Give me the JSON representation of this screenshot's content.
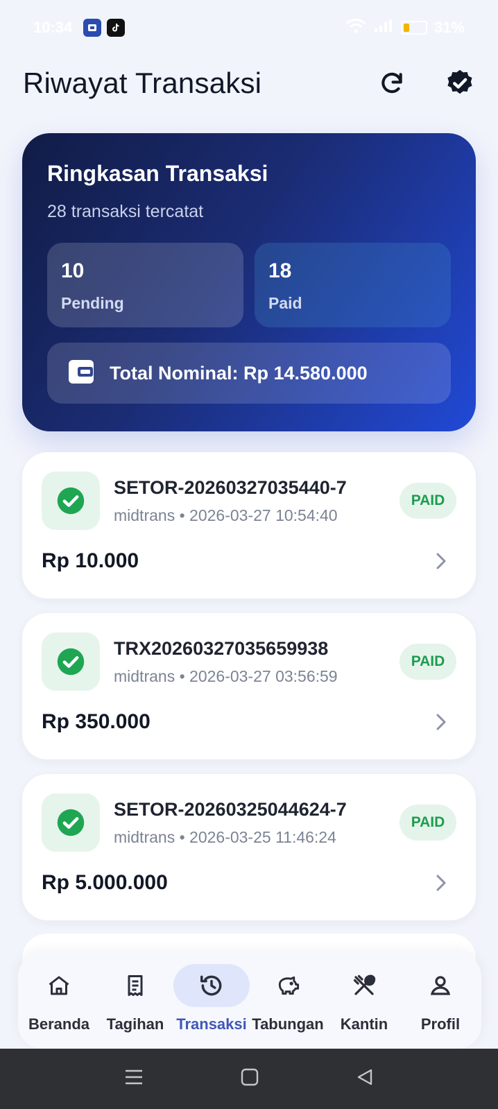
{
  "status_bar": {
    "time": "10:34",
    "battery_percent": "31%",
    "colors": {
      "battery_level": "#f4b400"
    }
  },
  "header": {
    "title": "Riwayat Transaksi",
    "icons": [
      "refresh-icon",
      "verified-badge-icon"
    ]
  },
  "summary": {
    "title": "Ringkasan Transaksi",
    "subtitle": "28 transaksi tercatat",
    "pending": {
      "count": "10",
      "label": "Pending"
    },
    "paid": {
      "count": "18",
      "label": "Paid"
    },
    "total_label": "Total Nominal: Rp 14.580.000",
    "colors": {
      "gradient_start": "#111c46",
      "gradient_end": "#2149d6"
    }
  },
  "transactions": [
    {
      "id": "SETOR-20260327035440-7",
      "meta": "midtrans • 2026-03-27 10:54:40",
      "status": "PAID",
      "amount": "Rp 10.000"
    },
    {
      "id": "TRX20260327035659938",
      "meta": "midtrans • 2026-03-27 03:56:59",
      "status": "PAID",
      "amount": "Rp 350.000"
    },
    {
      "id": "SETOR-20260325044624-7",
      "meta": "midtrans • 2026-03-25 11:46:24",
      "status": "PAID",
      "amount": "Rp 5.000.000"
    }
  ],
  "status_colors": {
    "paid_bg": "#e5f4ea",
    "paid_text": "#1e9c4f"
  },
  "bottom_nav": {
    "items": [
      {
        "label": "Beranda",
        "icon": "home-icon"
      },
      {
        "label": "Tagihan",
        "icon": "receipt-icon"
      },
      {
        "label": "Transaksi",
        "icon": "history-icon",
        "active": true
      },
      {
        "label": "Tabungan",
        "icon": "piggy-bank-icon"
      },
      {
        "label": "Kantin",
        "icon": "utensils-icon"
      },
      {
        "label": "Profil",
        "icon": "user-icon"
      }
    ],
    "active_color": "#3f57b8"
  }
}
